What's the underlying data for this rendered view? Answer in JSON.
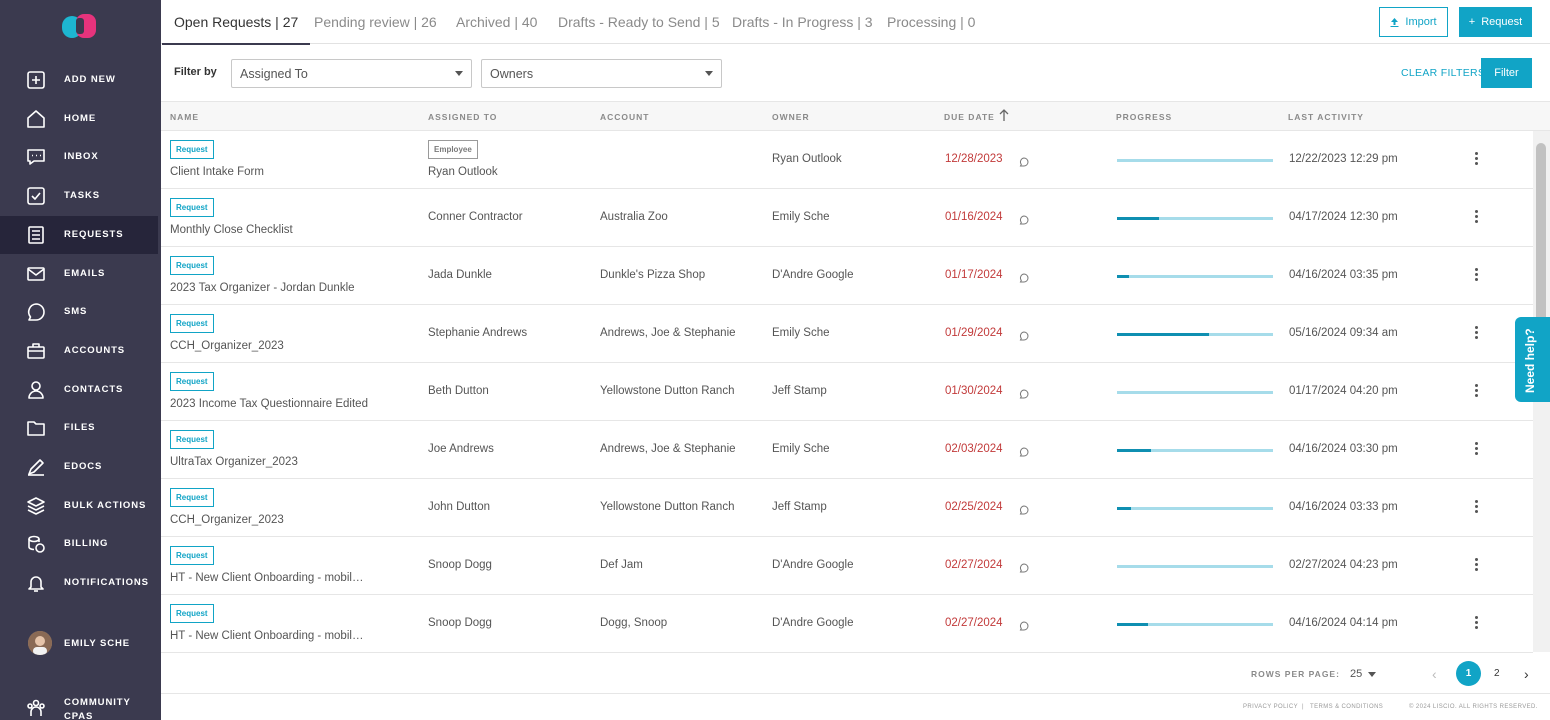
{
  "sidebar": {
    "items": [
      {
        "label": "ADD NEW",
        "icon": "plus-square-icon",
        "active": false
      },
      {
        "label": "HOME",
        "icon": "home-icon",
        "active": false
      },
      {
        "label": "INBOX",
        "icon": "message-square-icon",
        "active": false
      },
      {
        "label": "TASKS",
        "icon": "checkbox-icon",
        "active": false
      },
      {
        "label": "REQUESTS",
        "icon": "list-icon",
        "active": true
      },
      {
        "label": "EMAILS",
        "icon": "mail-icon",
        "active": false
      },
      {
        "label": "SMS",
        "icon": "chat-bubble-icon",
        "active": false
      },
      {
        "label": "ACCOUNTS",
        "icon": "briefcase-icon",
        "active": false
      },
      {
        "label": "CONTACTS",
        "icon": "person-icon",
        "active": false
      },
      {
        "label": "FILES",
        "icon": "folder-icon",
        "active": false
      },
      {
        "label": "EDOCS",
        "icon": "pen-icon",
        "active": false
      },
      {
        "label": "BULK ACTIONS",
        "icon": "layers-icon",
        "active": false
      },
      {
        "label": "BILLING",
        "icon": "coins-icon",
        "active": false
      },
      {
        "label": "NOTIFICATIONS",
        "icon": "bell-icon",
        "active": false
      }
    ],
    "user": "EMILY SCHE",
    "community_line1": "COMMUNITY",
    "community_line2": "CPAS"
  },
  "tabs": [
    {
      "label": "Open Requests | 27",
      "active": true
    },
    {
      "label": "Pending review | 26",
      "active": false
    },
    {
      "label": "Archived | 40",
      "active": false
    },
    {
      "label": "Drafts - Ready to Send | 5",
      "active": false
    },
    {
      "label": "Drafts - In Progress | 3",
      "active": false
    },
    {
      "label": "Processing | 0",
      "active": false
    }
  ],
  "header_buttons": {
    "import": "Import",
    "request": "Request"
  },
  "filters": {
    "label": "Filter by",
    "assigned_to": "Assigned To",
    "owners": "Owners",
    "clear": "CLEAR FILTERS",
    "filter": "Filter"
  },
  "table": {
    "columns": [
      "NAME",
      "ASSIGNED TO",
      "ACCOUNT",
      "OWNER",
      "DUE DATE",
      "PROGRESS",
      "LAST ACTIVITY"
    ],
    "rows": [
      {
        "badge": "Request",
        "name": "Client Intake Form",
        "assigned_badge": "Employee",
        "assigned": "Ryan Outlook",
        "account": "",
        "owner": "Ryan Outlook",
        "due": "12/28/2023",
        "progress": 0.0,
        "activity": "12/22/2023 12:29 pm"
      },
      {
        "badge": "Request",
        "name": "Monthly Close Checklist",
        "assigned_badge": "",
        "assigned": "Conner Contractor",
        "account": "Australia Zoo",
        "owner": "Emily Sche",
        "due": "01/16/2024",
        "progress": 0.27,
        "activity": "04/17/2024 12:30 pm"
      },
      {
        "badge": "Request",
        "name": "2023 Tax Organizer - Jordan Dunkle",
        "assigned_badge": "",
        "assigned": "Jada Dunkle",
        "account": "Dunkle's Pizza Shop",
        "owner": "D'Andre Google",
        "due": "01/17/2024",
        "progress": 0.08,
        "activity": "04/16/2024 03:35 pm"
      },
      {
        "badge": "Request",
        "name": "CCH_Organizer_2023",
        "assigned_badge": "",
        "assigned": "Stephanie Andrews",
        "account": "Andrews, Joe & Stephanie",
        "owner": "Emily Sche",
        "due": "01/29/2024",
        "progress": 0.59,
        "activity": "05/16/2024 09:34 am"
      },
      {
        "badge": "Request",
        "name": "2023 Income Tax Questionnaire Edited",
        "assigned_badge": "",
        "assigned": "Beth Dutton",
        "account": "Yellowstone Dutton Ranch",
        "owner": "Jeff Stamp",
        "due": "01/30/2024",
        "progress": 0.0,
        "activity": "01/17/2024 04:20 pm"
      },
      {
        "badge": "Request",
        "name": "UltraTax Organizer_2023",
        "assigned_badge": "",
        "assigned": "Joe Andrews",
        "account": "Andrews, Joe & Stephanie",
        "owner": "Emily Sche",
        "due": "02/03/2024",
        "progress": 0.22,
        "activity": "04/16/2024 03:30 pm"
      },
      {
        "badge": "Request",
        "name": "CCH_Organizer_2023",
        "assigned_badge": "",
        "assigned": "John Dutton",
        "account": "Yellowstone Dutton Ranch",
        "owner": "Jeff Stamp",
        "due": "02/25/2024",
        "progress": 0.09,
        "activity": "04/16/2024 03:33 pm"
      },
      {
        "badge": "Request",
        "name": "HT - New Client Onboarding - mobil…",
        "assigned_badge": "",
        "assigned": "Snoop Dogg",
        "account": "Def Jam",
        "owner": "D'Andre Google",
        "due": "02/27/2024",
        "progress": 0.0,
        "activity": "02/27/2024 04:23 pm"
      },
      {
        "badge": "Request",
        "name": "HT - New Client Onboarding - mobil…",
        "assigned_badge": "",
        "assigned": "Snoop Dogg",
        "account": "Dogg, Snoop",
        "owner": "D'Andre Google",
        "due": "02/27/2024",
        "progress": 0.2,
        "activity": "04/16/2024 04:14 pm"
      }
    ]
  },
  "pagination": {
    "rows_label": "ROWS PER PAGE:",
    "rows_value": "25",
    "page1": "1",
    "page2": "2",
    "prev": "‹",
    "next": "›"
  },
  "help": "Need help?",
  "footer": {
    "privacy": "PRIVACY POLICY",
    "sep": "|",
    "terms": "TERMS & CONDITIONS",
    "copyright": "© 2024 LISCIO. ALL RIGHTS RESERVED."
  },
  "colors": {
    "accent": "#11a4c6",
    "sidebar": "#3b3a4f",
    "sidebar_active": "#26253a",
    "due": "#c23a3a",
    "progress_track": "#a6dcea",
    "progress_fill": "#0f8fb1"
  }
}
